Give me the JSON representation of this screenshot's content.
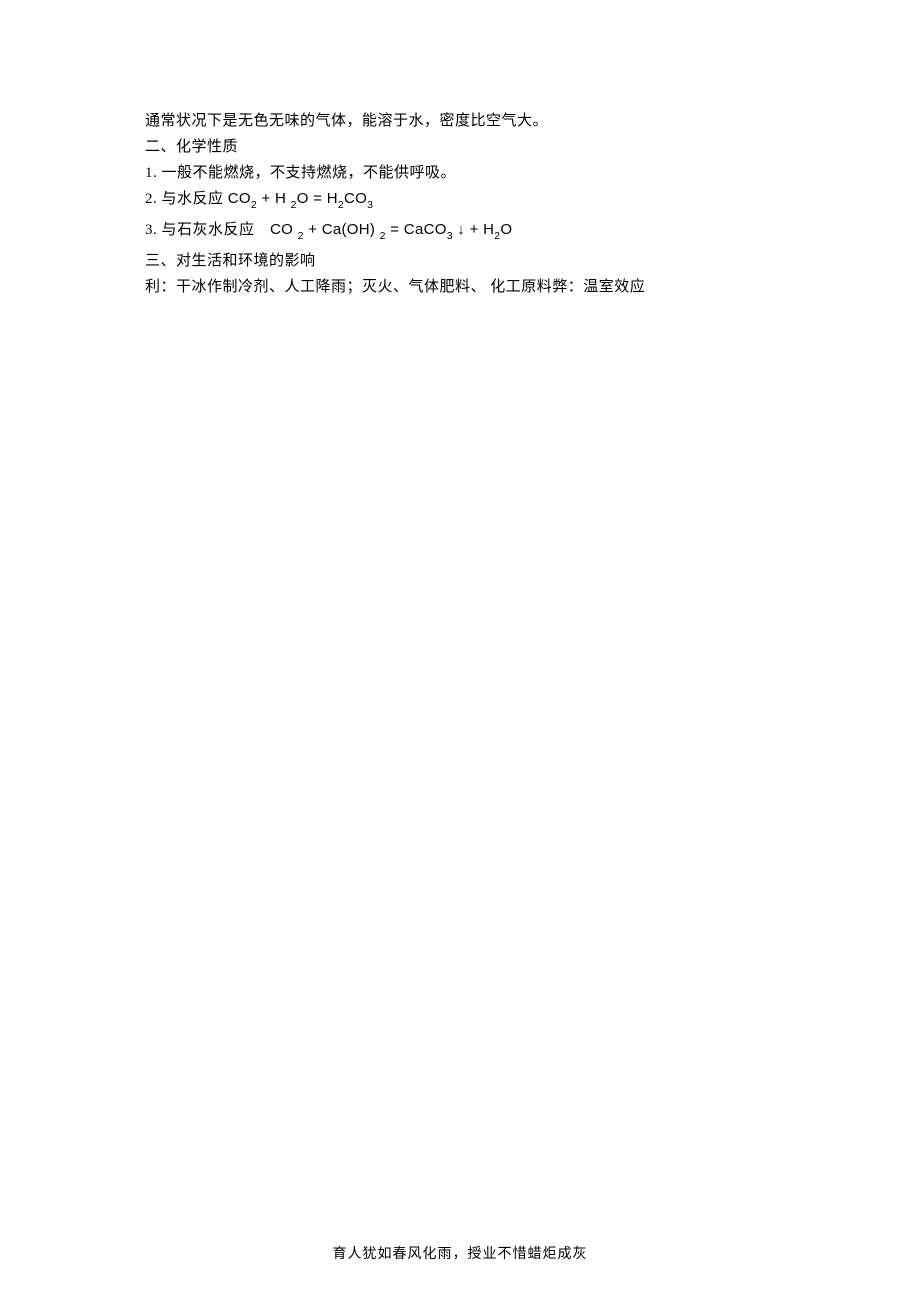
{
  "content": {
    "line1": "通常状况下是无色无味的气体，能溶于水，密度比空气大。",
    "line2": "二、化学性质",
    "line3": "1. 一般不能燃烧，不支持燃烧，不能供呼吸。",
    "line4_prefix": "2. 与水反应 ",
    "line4_formula": {
      "p1": "CO",
      "s1": "2",
      "p2": " + H ",
      "s2": "2",
      "p3": "O = H",
      "s3": "2",
      "p4": "CO",
      "s4": "3"
    },
    "line5_prefix": "3. 与石灰水反应　",
    "line5_formula": {
      "p1": "CO ",
      "s1": "2",
      "p2": " + Ca(OH) ",
      "s2": "2",
      "p3": " = CaCO",
      "s3": "3",
      "p4": " ↓  + H",
      "s4": "2",
      "p5": "O"
    },
    "line6": "三、对生活和环境的影响",
    "line7": "利：干冰作制冷剂、人工降雨；灭火、气体肥料、 化工原料弊：温室效应"
  },
  "footer": "育人犹如春风化雨，授业不惜蜡炬成灰"
}
